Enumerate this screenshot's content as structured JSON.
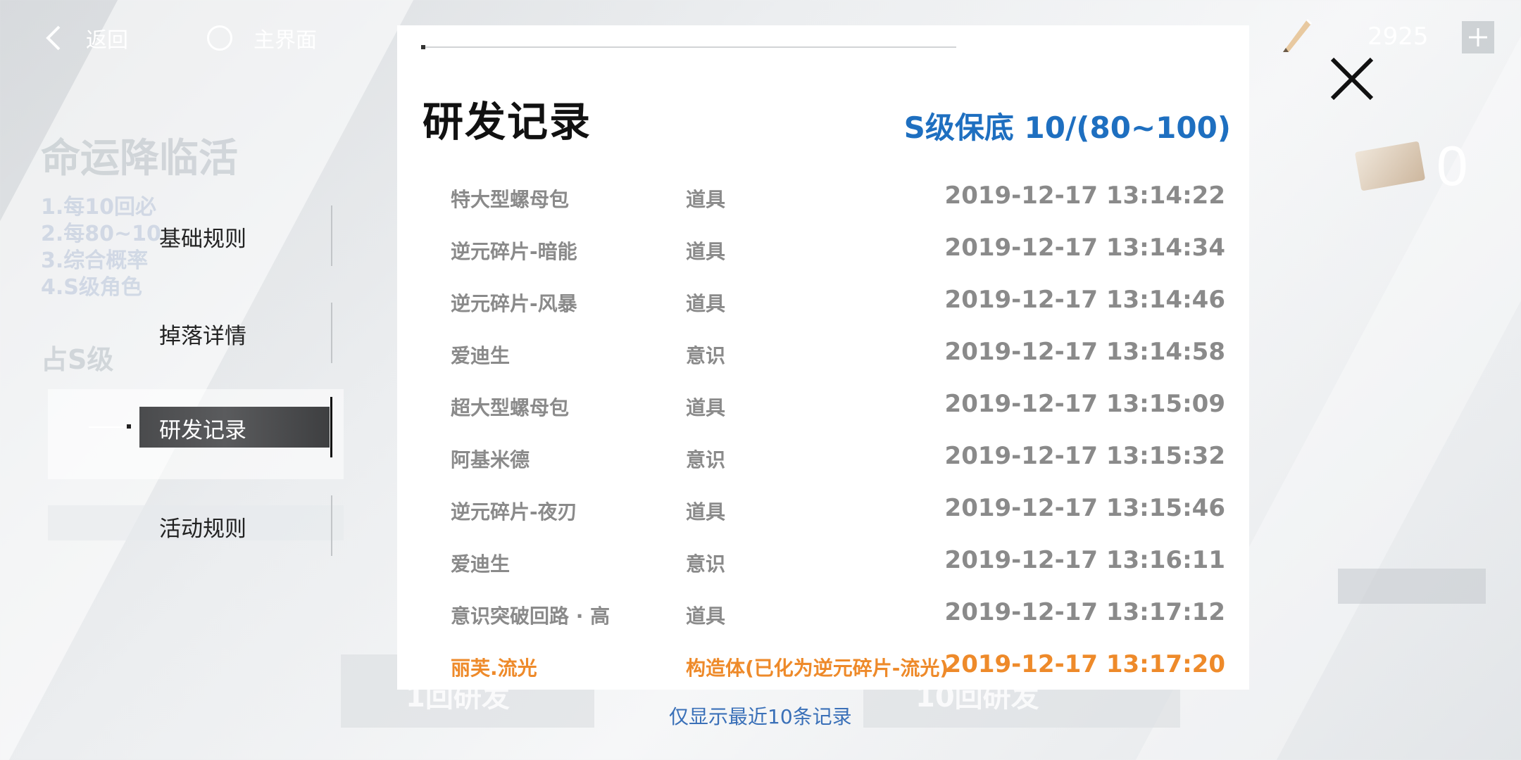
{
  "topbar": {
    "back_label": "返回",
    "home_label": "主界面",
    "currency_value": "2925"
  },
  "ticket_count": "0",
  "background": {
    "ghost_title": "命运降临活",
    "ghost_lines": [
      "1.每10回必",
      "2.每80~10",
      "3.综合概率",
      "4.S级角色"
    ],
    "ghost_sub": "占S级",
    "button_left": "1回研发",
    "button_right": "10回研发"
  },
  "menu": {
    "items": [
      {
        "label": "基础规则",
        "active": false
      },
      {
        "label": "掉落详情",
        "active": false
      },
      {
        "label": "研发记录",
        "active": true
      },
      {
        "label": "活动规则",
        "active": false
      }
    ]
  },
  "panel": {
    "title": "研发记录",
    "pity": "S级保底 10/(80~100)",
    "records": [
      {
        "name": "特大型螺母包",
        "type": "道具",
        "time": "2019-12-17 13:14:22",
        "highlight": false
      },
      {
        "name": "逆元碎片-暗能",
        "type": "道具",
        "time": "2019-12-17 13:14:34",
        "highlight": false
      },
      {
        "name": "逆元碎片-风暴",
        "type": "道具",
        "time": "2019-12-17 13:14:46",
        "highlight": false
      },
      {
        "name": "爱迪生",
        "type": "意识",
        "time": "2019-12-17 13:14:58",
        "highlight": false
      },
      {
        "name": "超大型螺母包",
        "type": "道具",
        "time": "2019-12-17 13:15:09",
        "highlight": false
      },
      {
        "name": "阿基米德",
        "type": "意识",
        "time": "2019-12-17 13:15:32",
        "highlight": false
      },
      {
        "name": "逆元碎片-夜刃",
        "type": "道具",
        "time": "2019-12-17 13:15:46",
        "highlight": false
      },
      {
        "name": "爱迪生",
        "type": "意识",
        "time": "2019-12-17 13:16:11",
        "highlight": false
      },
      {
        "name": "意识突破回路 · 高",
        "type": "道具",
        "time": "2019-12-17 13:17:12",
        "highlight": false
      },
      {
        "name": "丽芙.流光",
        "type": "构造体(已化为逆元碎片-流光)",
        "time": "2019-12-17 13:17:20",
        "highlight": true
      }
    ],
    "note": "仅显示最近10条记录"
  },
  "colors": {
    "pity_blue": "#1e6fc0",
    "highlight_orange": "#ee8a2a",
    "note_blue": "#3a70b8"
  }
}
